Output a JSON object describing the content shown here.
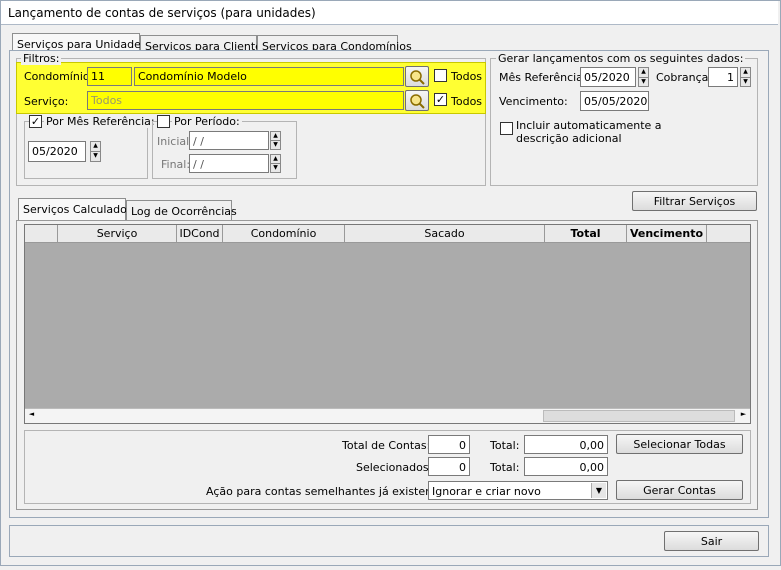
{
  "window": {
    "title": "Lançamento de contas de serviços (para unidades)"
  },
  "tabs": [
    {
      "label": "Serviços para Unidades",
      "active": true
    },
    {
      "label": "Serviços para Clientes",
      "active": false
    },
    {
      "label": "Serviços para Condomínios",
      "active": false
    }
  ],
  "filters": {
    "legend": "Filtros:",
    "condominio_label": "Condomínio:",
    "condominio_id": "11",
    "condominio_name": "Condomínio Modelo",
    "condominio_todos": "Todos",
    "condominio_todos_checked": false,
    "servico_label": "Serviço:",
    "servico_placeholder": "Todos",
    "servico_todos": "Todos",
    "servico_todos_checked": true,
    "por_mes_label": "Por Mês Referência:",
    "por_mes_checked": true,
    "mes_value": "05/2020",
    "por_periodo_label": "Por Período:",
    "por_periodo_checked": false,
    "inicial_label": "Inicial:",
    "inicial_value": "  /  /",
    "final_label": "Final:",
    "final_value": "  /  /"
  },
  "gerar": {
    "legend": "Gerar lançamentos com os seguintes dados:",
    "mes_ref_label": "Mês Referência:",
    "mes_ref_value": "05/2020",
    "cobranca_label": "Cobrança:",
    "cobranca_value": "1",
    "vencimento_label": "Vencimento:",
    "vencimento_value": "05/05/2020",
    "incluir_label_1": "Incluir automaticamente a",
    "incluir_label_2": "descrição adicional",
    "incluir_checked": false
  },
  "filtrar_button": "Filtrar Serviços",
  "result_tabs": [
    {
      "label": "Serviços Calculados",
      "active": true
    },
    {
      "label": "Log de Ocorrências",
      "active": false
    }
  ],
  "grid": {
    "columns": [
      "Serviço",
      "IDCond",
      "Condomínio",
      "Sacado",
      "Total",
      "Vencimento"
    ]
  },
  "totals": {
    "total_contas_label": "Total de Contas:",
    "total_contas_value": "0",
    "total_label": "Total:",
    "total_value": "0,00",
    "selecionados_label": "Selecionados:",
    "selecionados_value": "0",
    "total2_label": "Total:",
    "total2_value": "0,00",
    "acao_label": "Ação para contas semelhantes já existentes:",
    "acao_value": "Ignorar e criar novo"
  },
  "selecionar_button": "Selecionar Todas",
  "gerar_button": "Gerar Contas",
  "sair_button": "Sair"
}
